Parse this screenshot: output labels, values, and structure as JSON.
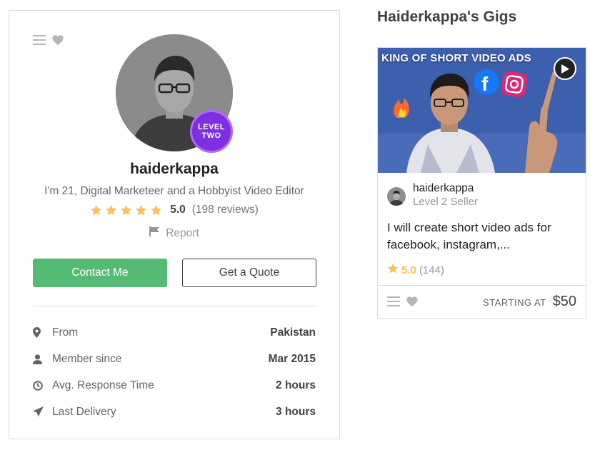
{
  "colors": {
    "accent_green": "#56bb72",
    "star_yellow": "#ffbe5b",
    "level_purple": "#7e2fe0",
    "thumb_blue": "#3c5fae"
  },
  "profile": {
    "icons": [
      "menu-icon",
      "heart-icon"
    ],
    "level_badge": {
      "line1": "LEVEL",
      "line2": "TWO"
    },
    "username": "haiderkappa",
    "tagline": "I'm 21, Digital Marketeer and a Hobbyist Video Editor",
    "rating": {
      "stars": 5,
      "score": "5.0",
      "count": "(198 reviews)"
    },
    "report_label": "Report",
    "contact_label": "Contact Me",
    "quote_label": "Get a Quote",
    "stats": [
      {
        "icon": "location-pin-icon",
        "label": "From",
        "value": "Pakistan"
      },
      {
        "icon": "user-icon",
        "label": "Member since",
        "value": "Mar 2015"
      },
      {
        "icon": "clock-icon",
        "label": "Avg. Response Time",
        "value": "2 hours"
      },
      {
        "icon": "paper-plane-icon",
        "label": "Last Delivery",
        "value": "3 hours"
      }
    ]
  },
  "gigs": {
    "title": "Haiderkappa's Gigs",
    "items": [
      {
        "thumb_heading": "KING OF SHORT VIDEO ADS",
        "seller_name": "haiderkappa",
        "seller_level": "Level 2 Seller",
        "description": "I will create short video ads for facebook, instagram,...",
        "rating_score": "5.0",
        "rating_count": "(144)",
        "starting_label": "STARTING AT",
        "price": "$50"
      }
    ]
  }
}
